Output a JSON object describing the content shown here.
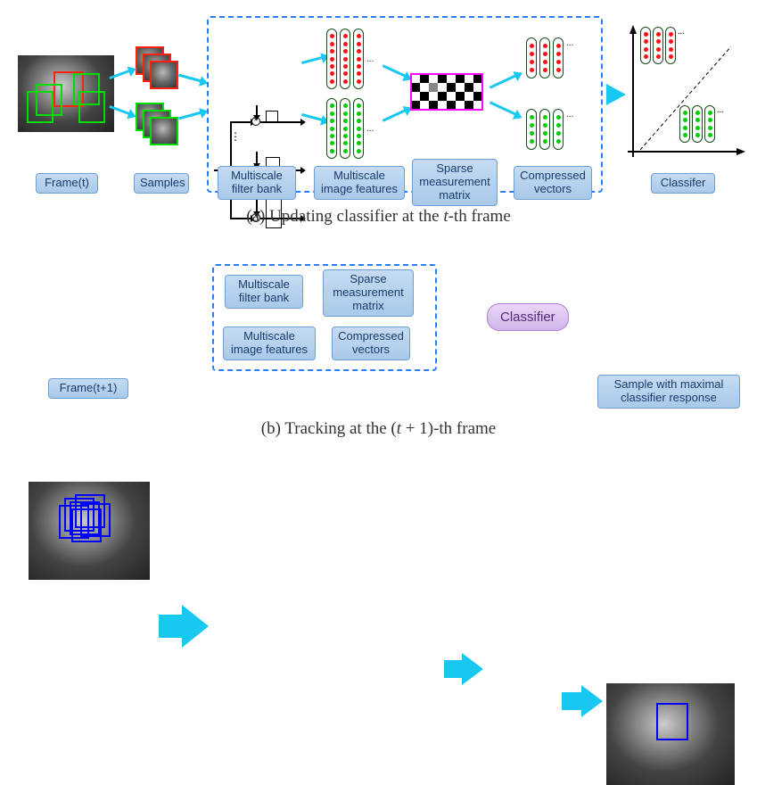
{
  "partA": {
    "frame_label": "Frame(t)",
    "samples_label": "Samples",
    "filterbank_label": "Multiscale\nfilter bank",
    "features_label": "Multiscale\nimage features",
    "matrix_label": "Sparse\nmeasurement\nmatrix",
    "compressed_label": "Compressed\nvectors",
    "classifier_label": "Classifer",
    "caption_prefix": "(a) Updating classifier at the ",
    "caption_var": "t",
    "caption_suffix": "-th frame"
  },
  "partB": {
    "frame_label": "Frame(t+1)",
    "filterbank_label": "Multiscale\nfilter bank",
    "features_label": "Multiscale\nimage features",
    "matrix_label": "Sparse\nmeasurement\nmatrix",
    "compressed_label": "Compressed\nvectors",
    "classifier_label": "Classifier",
    "result_label": "Sample with maximal\nclassifier response",
    "caption_prefix": "(b) Tracking at the (",
    "caption_var": "t",
    "caption_suffix": " + 1)-th frame"
  },
  "colors": {
    "arrow": "#18c8f0",
    "pos_sample": "#f21",
    "neg_sample": "#0d0",
    "candidate": "#00f"
  }
}
